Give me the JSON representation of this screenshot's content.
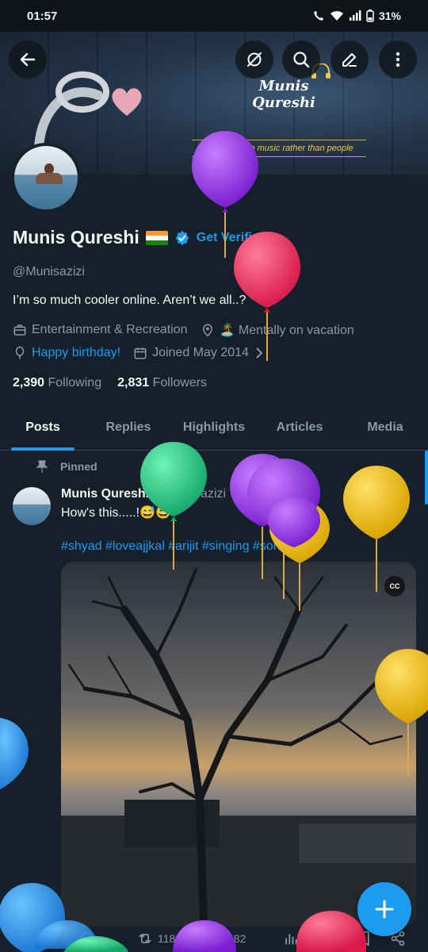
{
  "status_bar": {
    "time": "01:57",
    "battery": "31%"
  },
  "banner": {
    "brand": "Munis Qureshi",
    "tagline": "I'm more into music rather than people"
  },
  "profile": {
    "display_name": "Munis Qureshi",
    "get_verified": "Get Verified",
    "handle": "@Munisazizi",
    "bio": "I’m so much cooler online. Aren’t we all..?",
    "category": "Entertainment & Recreation",
    "location": "🏝️ Mentally on vacation",
    "birthday": "Happy birthday!",
    "joined": "Joined May 2014",
    "following_count": "2,390",
    "following_label": "Following",
    "followers_count": "2,831",
    "followers_label": "Followers"
  },
  "tabs": [
    {
      "label": "Posts",
      "active": true
    },
    {
      "label": "Replies",
      "active": false
    },
    {
      "label": "Highlights",
      "active": false
    },
    {
      "label": "Articles",
      "active": false
    },
    {
      "label": "Media",
      "active": false
    }
  ],
  "post": {
    "pinned_label": "Pinned",
    "author_name": "Munis Qureshi",
    "author_handle": "@Munisazizi · Jan 20",
    "text": "How's this.....!😅😅",
    "hashtags": "#shyad #loveajjkal #arijit #singing #song",
    "cc_label": "CC",
    "retweets": "118",
    "views": "582"
  },
  "icons": {
    "back": "back-arrow-icon",
    "grok": "grok-icon",
    "search": "search-icon",
    "edit": "edit-icon",
    "more": "more-icon",
    "verified": "verified-badge-icon",
    "compose": "plus-icon"
  },
  "colors": {
    "accent": "#1d9bf0",
    "background": "#15202b",
    "muted": "#8b98a5"
  }
}
